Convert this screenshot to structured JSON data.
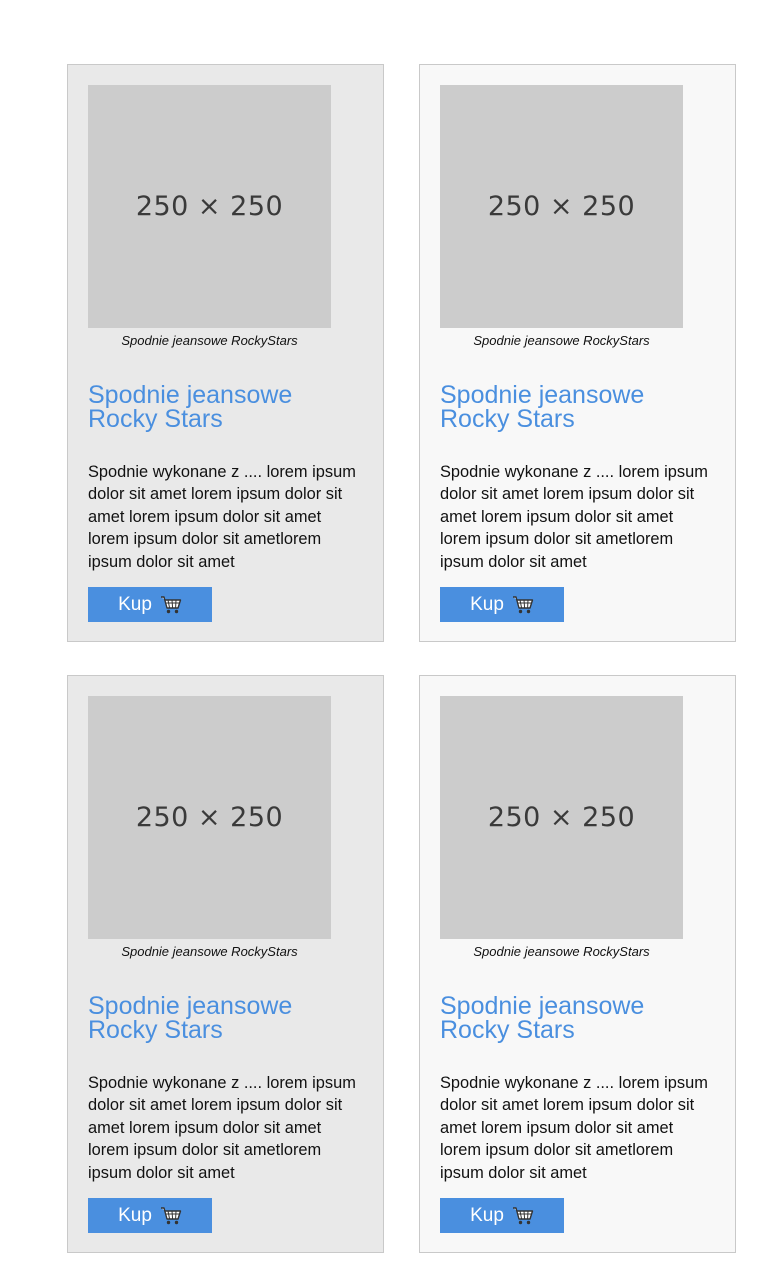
{
  "products": [
    {
      "image_placeholder": "250 × 250",
      "caption": "Spodnie jeansowe RockyStars",
      "title": "Spodnie jeansowe Rocky Stars",
      "description": "Spodnie wykonane z .... lorem ipsum dolor sit amet lorem ipsum dolor sit amet lorem ipsum dolor sit amet lorem ipsum dolor sit ametlorem ipsum dolor sit amet",
      "buy_label": "Kup",
      "icon": "cart-icon"
    },
    {
      "image_placeholder": "250 × 250",
      "caption": "Spodnie jeansowe RockyStars",
      "title": "Spodnie jeansowe Rocky Stars",
      "description": "Spodnie wykonane z .... lorem ipsum dolor sit amet lorem ipsum dolor sit amet lorem ipsum dolor sit amet lorem ipsum dolor sit ametlorem ipsum dolor sit amet",
      "buy_label": "Kup",
      "icon": "cart-icon"
    },
    {
      "image_placeholder": "250 × 250",
      "caption": "Spodnie jeansowe RockyStars",
      "title": "Spodnie jeansowe Rocky Stars",
      "description": "Spodnie wykonane z .... lorem ipsum dolor sit amet lorem ipsum dolor sit amet lorem ipsum dolor sit amet lorem ipsum dolor sit ametlorem ipsum dolor sit amet",
      "buy_label": "Kup",
      "icon": "cart-icon"
    },
    {
      "image_placeholder": "250 × 250",
      "caption": "Spodnie jeansowe RockyStars",
      "title": "Spodnie jeansowe Rocky Stars",
      "description": "Spodnie wykonane z .... lorem ipsum dolor sit amet lorem ipsum dolor sit amet lorem ipsum dolor sit amet lorem ipsum dolor sit ametlorem ipsum dolor sit amet",
      "buy_label": "Kup",
      "icon": "cart-icon"
    }
  ],
  "colors": {
    "accent": "#4a8fdf",
    "card_dark": "#e9e9e9",
    "card_light": "#f8f8f8",
    "placeholder": "#cccccc"
  }
}
